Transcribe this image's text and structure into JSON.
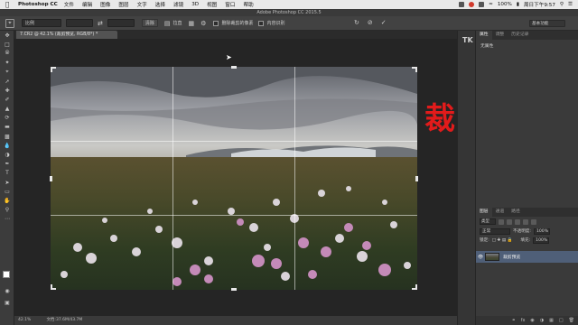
{
  "menubar": {
    "app": "Photoshop CC",
    "items": [
      "文件",
      "编辑",
      "图像",
      "图层",
      "文字",
      "选择",
      "滤镜",
      "3D",
      "视图",
      "窗口",
      "帮助"
    ],
    "battery": "100%",
    "clock": "周日下午9:57"
  },
  "window_title": "Adobe Photoshop CC 2015.5",
  "options": {
    "ratio": "比例",
    "clear_label": "清除",
    "straighten_label": "拉直",
    "delete_cropped_label": "删除裁剪的像素",
    "content_aware_label": "内容识别",
    "workspace": "基本功能"
  },
  "document_tab": "7.CR2 @ 42.1% (裁剪预览, RGB/8*) *",
  "overlay_text": "裁剪",
  "status": {
    "zoom": "42.1%",
    "doc": "文档:37.6M/43.7M"
  },
  "dock": {
    "tk_label": "TK"
  },
  "panels": {
    "tabs": [
      "属性",
      "调整",
      "历史记录"
    ],
    "properties_title": "无属性",
    "layer_tabs": [
      "图层",
      "通道",
      "路径"
    ],
    "kind_label": "类型",
    "blend_mode": "正常",
    "opacity_label": "不透明度:",
    "opacity_value": "100%",
    "lock_label": "锁定:",
    "fill_label": "填充:",
    "fill_value": "100%",
    "layer_name": "裁剪预览"
  },
  "colors": {
    "accent_text": "#e21b1b",
    "layer_selected": "#4f5f78",
    "foreground": "#ffffff",
    "background": "#000000"
  }
}
